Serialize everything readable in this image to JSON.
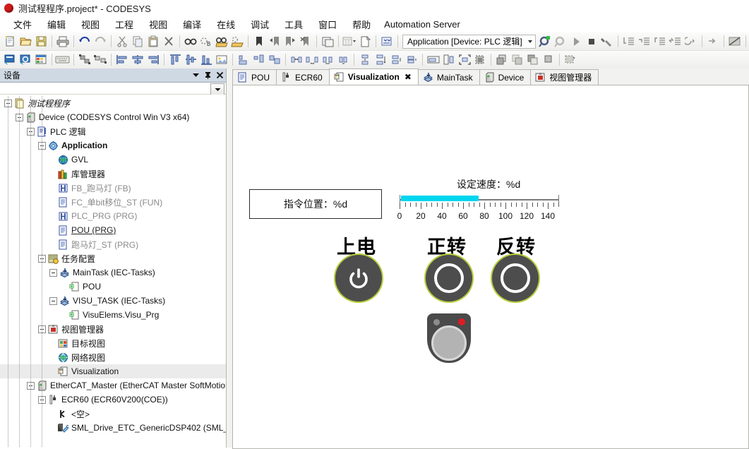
{
  "window": {
    "title": "测试程程序.project* - CODESYS",
    "dot_color": "#d01a1a"
  },
  "menubar": {
    "items": [
      {
        "label": "文件"
      },
      {
        "label": "编辑"
      },
      {
        "label": "视图"
      },
      {
        "label": "工程"
      },
      {
        "label": "视图"
      },
      {
        "label": "编译"
      },
      {
        "label": "在线"
      },
      {
        "label": "调试"
      },
      {
        "label": "工具"
      },
      {
        "label": "窗口"
      },
      {
        "label": "帮助"
      },
      {
        "label": "Automation Server"
      }
    ]
  },
  "toolbar": {
    "application_combo": "Application [Device: PLC 逻辑]",
    "row1_icons": [
      "new-file-icon",
      "open-folder-icon",
      "save-icon",
      "print-icon",
      "undo-icon",
      "redo-icon",
      "cut-icon",
      "copy-icon",
      "paste-icon",
      "delete-icon",
      "find-icon",
      "find-next-icon",
      "find-in-project-icon",
      "find-replace-icon",
      "bookmark-icon",
      "bookmark-prev-icon",
      "bookmark-next-icon",
      "bookmark-clear-icon",
      "clipboard-list-icon",
      "grid-dropdown-icon",
      "new-object-icon",
      "compile-icon"
    ],
    "row1_after_combo_icons": [
      "login-icon",
      "logout-icon",
      "run-icon",
      "stop-icon",
      "tools-icon",
      "step-into-icon",
      "step-over-icon",
      "step-out-icon",
      "run-to-cursor-icon",
      "set-next-icon",
      "jump-icon",
      "breakpoint-toggle-icon"
    ],
    "row2_icons": [
      "visu-editor-icon",
      "visu-zoom-icon",
      "visu-table-icon",
      "keyboard-icon",
      "group-icon",
      "ungroup-icon",
      "align-left-icon",
      "align-center-icon",
      "align-right-icon",
      "align-top-icon",
      "align-middle-icon",
      "align-bottom-icon",
      "image-icon",
      "same-width-icon",
      "same-height-icon",
      "same-size-icon",
      "space-h-even-icon",
      "space-h-inc-icon",
      "space-h-dec-icon",
      "space-v-even-icon",
      "space-v-inc-icon",
      "space-v-dec-icon",
      "space-v-clear-icon",
      "fit-width-icon",
      "fit-height-icon",
      "fit-size-icon",
      "bring-front-icon",
      "order-icon",
      "send-back-icon",
      "order2-icon",
      "order3-icon",
      "layer-icon"
    ]
  },
  "devices_panel": {
    "title": "设备",
    "header_icons": [
      "chevron-down-icon",
      "pin-icon",
      "close-icon"
    ],
    "dropdown_icon": "chevron-down-icon",
    "tree": [
      {
        "depth": 0,
        "node": "minus",
        "icon": "project-icon",
        "label": "测试程程序",
        "style": "italic"
      },
      {
        "depth": 1,
        "node": "minus",
        "icon": "device-icon",
        "label": "Device (CODESYS Control Win V3 x64)",
        "style": ""
      },
      {
        "depth": 2,
        "node": "minus",
        "icon": "plc-logic-icon",
        "label": "PLC 逻辑",
        "style": ""
      },
      {
        "depth": 3,
        "node": "minus",
        "icon": "application-icon",
        "label": "Application",
        "style": "bold"
      },
      {
        "depth": 4,
        "node": "none",
        "icon": "gvl-icon",
        "label": "GVL",
        "style": ""
      },
      {
        "depth": 4,
        "node": "none",
        "icon": "library-icon",
        "label": "库管理器",
        "style": ""
      },
      {
        "depth": 4,
        "node": "none",
        "icon": "fb-icon",
        "label": "FB_跑马灯 (FB)",
        "style": "gray"
      },
      {
        "depth": 4,
        "node": "none",
        "icon": "st-icon",
        "label": "FC_单bit移位_ST (FUN)",
        "style": "gray"
      },
      {
        "depth": 4,
        "node": "none",
        "icon": "fb-icon",
        "label": "PLC_PRG (PRG)",
        "style": "gray"
      },
      {
        "depth": 4,
        "node": "none",
        "icon": "st-icon",
        "label": "POU (PRG)",
        "style": "underline"
      },
      {
        "depth": 4,
        "node": "none",
        "icon": "st-icon",
        "label": "跑马灯_ST (PRG)",
        "style": "gray"
      },
      {
        "depth": 3,
        "node": "minus",
        "icon": "task-config-icon",
        "label": "任务配置",
        "style": ""
      },
      {
        "depth": 4,
        "node": "minus",
        "icon": "task-icon",
        "label": "MainTask (IEC-Tasks)",
        "style": ""
      },
      {
        "depth": 5,
        "node": "none",
        "icon": "pou-ref-icon",
        "label": "POU",
        "style": ""
      },
      {
        "depth": 4,
        "node": "minus",
        "icon": "task-icon",
        "label": "VISU_TASK (IEC-Tasks)",
        "style": ""
      },
      {
        "depth": 5,
        "node": "none",
        "icon": "pou-ref-icon",
        "label": "VisuElems.Visu_Prg",
        "style": ""
      },
      {
        "depth": 3,
        "node": "minus",
        "icon": "visu-manager-icon",
        "label": "视图管理器",
        "style": ""
      },
      {
        "depth": 4,
        "node": "none",
        "icon": "target-visu-icon",
        "label": "目标视图",
        "style": ""
      },
      {
        "depth": 4,
        "node": "none",
        "icon": "web-visu-icon",
        "label": "网络视图",
        "style": ""
      },
      {
        "depth": 4,
        "node": "none",
        "icon": "visualization-icon",
        "label": "Visualization",
        "style": "selected"
      },
      {
        "depth": 2,
        "node": "minus",
        "icon": "device-icon",
        "label": "EtherCAT_Master (EtherCAT Master SoftMotion)",
        "style": ""
      },
      {
        "depth": 3,
        "node": "minus",
        "icon": "ethercat-slave-icon",
        "label": "ECR60 (ECR60V200(COE))",
        "style": ""
      },
      {
        "depth": 4,
        "node": "none",
        "icon": "empty-slot-icon",
        "label": "<空>",
        "style": ""
      },
      {
        "depth": 4,
        "node": "none",
        "icon": "drive-icon",
        "label": "SML_Drive_ETC_GenericDSP402 (SML_",
        "style": ""
      }
    ]
  },
  "editor": {
    "tabs": [
      {
        "label": "POU",
        "icon": "st-icon",
        "active": false,
        "closable": false
      },
      {
        "label": "ECR60",
        "icon": "ethercat-slave-icon",
        "active": false,
        "closable": false
      },
      {
        "label": "Visualization",
        "icon": "visualization-icon",
        "active": true,
        "closable": true,
        "close_glyph": "✖"
      },
      {
        "label": "MainTask",
        "icon": "task-icon",
        "active": false,
        "closable": false
      },
      {
        "label": "Device",
        "icon": "device-icon",
        "active": false,
        "closable": false
      },
      {
        "label": "视图管理器",
        "icon": "visu-manager-icon",
        "active": false,
        "closable": false
      }
    ],
    "scroll_icons": [
      "scroll-up-icon",
      "scroll-down-icon"
    ]
  },
  "visualization": {
    "command_position_box": "指令位置：%d",
    "set_speed_label": "设定速度：%d",
    "slider": {
      "min": 0,
      "max": 150,
      "value": 73,
      "tick_labels": [
        "0",
        "20",
        "40",
        "60",
        "80",
        "100",
        "120",
        "140"
      ],
      "tick_values": [
        0,
        20,
        40,
        60,
        80,
        100,
        120,
        140
      ],
      "fill_color": "#00d5f0",
      "track_color": "#7a7a7a"
    },
    "buttons": [
      {
        "label": "上电",
        "icon": "power-icon",
        "ring_color": "#b4cf3a",
        "body_color": "#4d4d4d"
      },
      {
        "label": "正转",
        "icon": "circle-ring-icon",
        "ring_color": "#b4cf3a",
        "body_color": "#4d4d4d"
      },
      {
        "label": "反转",
        "icon": "circle-ring-icon",
        "ring_color": "#b4cf3a",
        "body_color": "#4d4d4d"
      }
    ],
    "knob": {
      "name": "rotary-knob",
      "body_color": "#4a4a4a",
      "face_color": "#b3b3b3",
      "lamp_off_color": "#8c8c8c",
      "lamp_on_color": "#e01b24"
    }
  }
}
